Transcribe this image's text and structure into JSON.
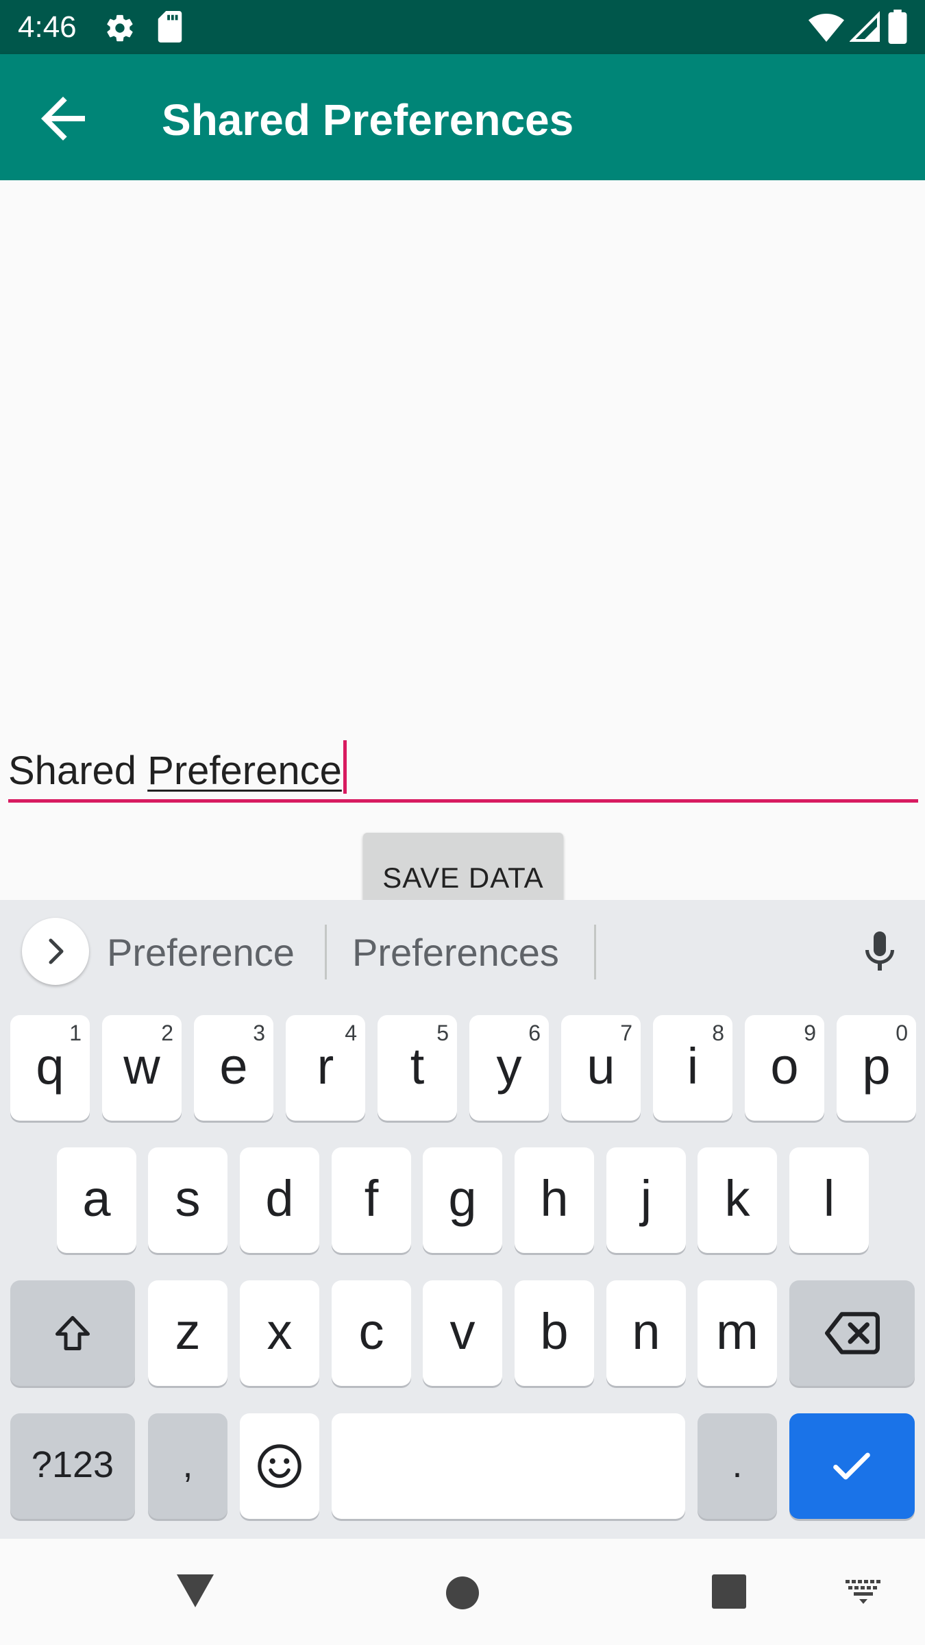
{
  "status_bar": {
    "time": "4:46",
    "left_icons": [
      "gear-icon",
      "sd-card-icon"
    ],
    "right_icons": [
      "wifi-icon",
      "signal-icon",
      "battery-icon"
    ]
  },
  "toolbar": {
    "title": "Shared Preferences",
    "back_icon": "arrow-back-icon"
  },
  "edit_text": {
    "plain_part": "Shared ",
    "composing_part": "Preference"
  },
  "save_button": {
    "label": "SAVE DATA"
  },
  "keyboard": {
    "suggestions": [
      "Preference",
      "Preferences"
    ],
    "row1": [
      {
        "k": "q",
        "h": "1"
      },
      {
        "k": "w",
        "h": "2"
      },
      {
        "k": "e",
        "h": "3"
      },
      {
        "k": "r",
        "h": "4"
      },
      {
        "k": "t",
        "h": "5"
      },
      {
        "k": "y",
        "h": "6"
      },
      {
        "k": "u",
        "h": "7"
      },
      {
        "k": "i",
        "h": "8"
      },
      {
        "k": "o",
        "h": "9"
      },
      {
        "k": "p",
        "h": "0"
      }
    ],
    "row2": [
      "a",
      "s",
      "d",
      "f",
      "g",
      "h",
      "j",
      "k",
      "l"
    ],
    "row3": [
      "z",
      "x",
      "c",
      "v",
      "b",
      "n",
      "m"
    ],
    "symbols_key": "?123",
    "comma_key": ",",
    "period_key": ".",
    "colors": {
      "background": "#e8eaed",
      "action": "#1a73e8",
      "function_key": "#c9cdd2"
    }
  },
  "colors": {
    "status_bar": "#00574b",
    "toolbar": "#008577",
    "accent": "#d81b60"
  }
}
